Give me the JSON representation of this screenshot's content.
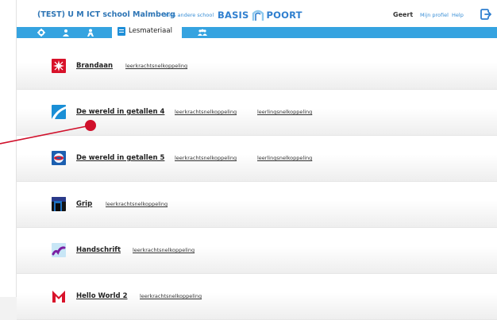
{
  "header": {
    "school": "(TEST) U M ICT school Malmberg",
    "switch_school": "Kies andere school",
    "logo_left": "BASIS",
    "logo_right": "POORT",
    "user": "Geert",
    "profile_link": "Mijn profiel",
    "help_link": "Help",
    "logout_icon": "logout-icon"
  },
  "nav": {
    "icons": [
      "gear-icon",
      "user-icon",
      "user-alt-icon",
      "group-icon"
    ],
    "active_tab": "Lesmateriaal"
  },
  "methods": [
    {
      "title": "Brandaan",
      "links": [
        "leerkrachtsnelkoppeling"
      ],
      "icon": "brandaan-logo-icon"
    },
    {
      "title": "De wereld in getallen 4",
      "links": [
        "leerkrachtsnelkoppeling",
        "leerlingsnelkoppeling"
      ],
      "icon": "wig4-logo-icon"
    },
    {
      "title": "De wereld in getallen 5",
      "links": [
        "leerkrachtsnelkoppeling",
        "leerlingsnelkoppeling"
      ],
      "icon": "wig5-logo-icon"
    },
    {
      "title": "Grip",
      "links": [
        "leerkrachtsnelkoppeling"
      ],
      "icon": "grip-logo-icon"
    },
    {
      "title": "Handschrift",
      "links": [
        "leerkrachtsnelkoppeling"
      ],
      "icon": "handschrift-logo-icon"
    },
    {
      "title": "Hello World 2",
      "links": [
        "leerkrachtsnelkoppeling"
      ],
      "icon": "hello-world-logo-icon"
    }
  ],
  "colors": {
    "accent": "#35a3e0",
    "link": "#3a8fd6",
    "annotation": "#d0102b"
  }
}
